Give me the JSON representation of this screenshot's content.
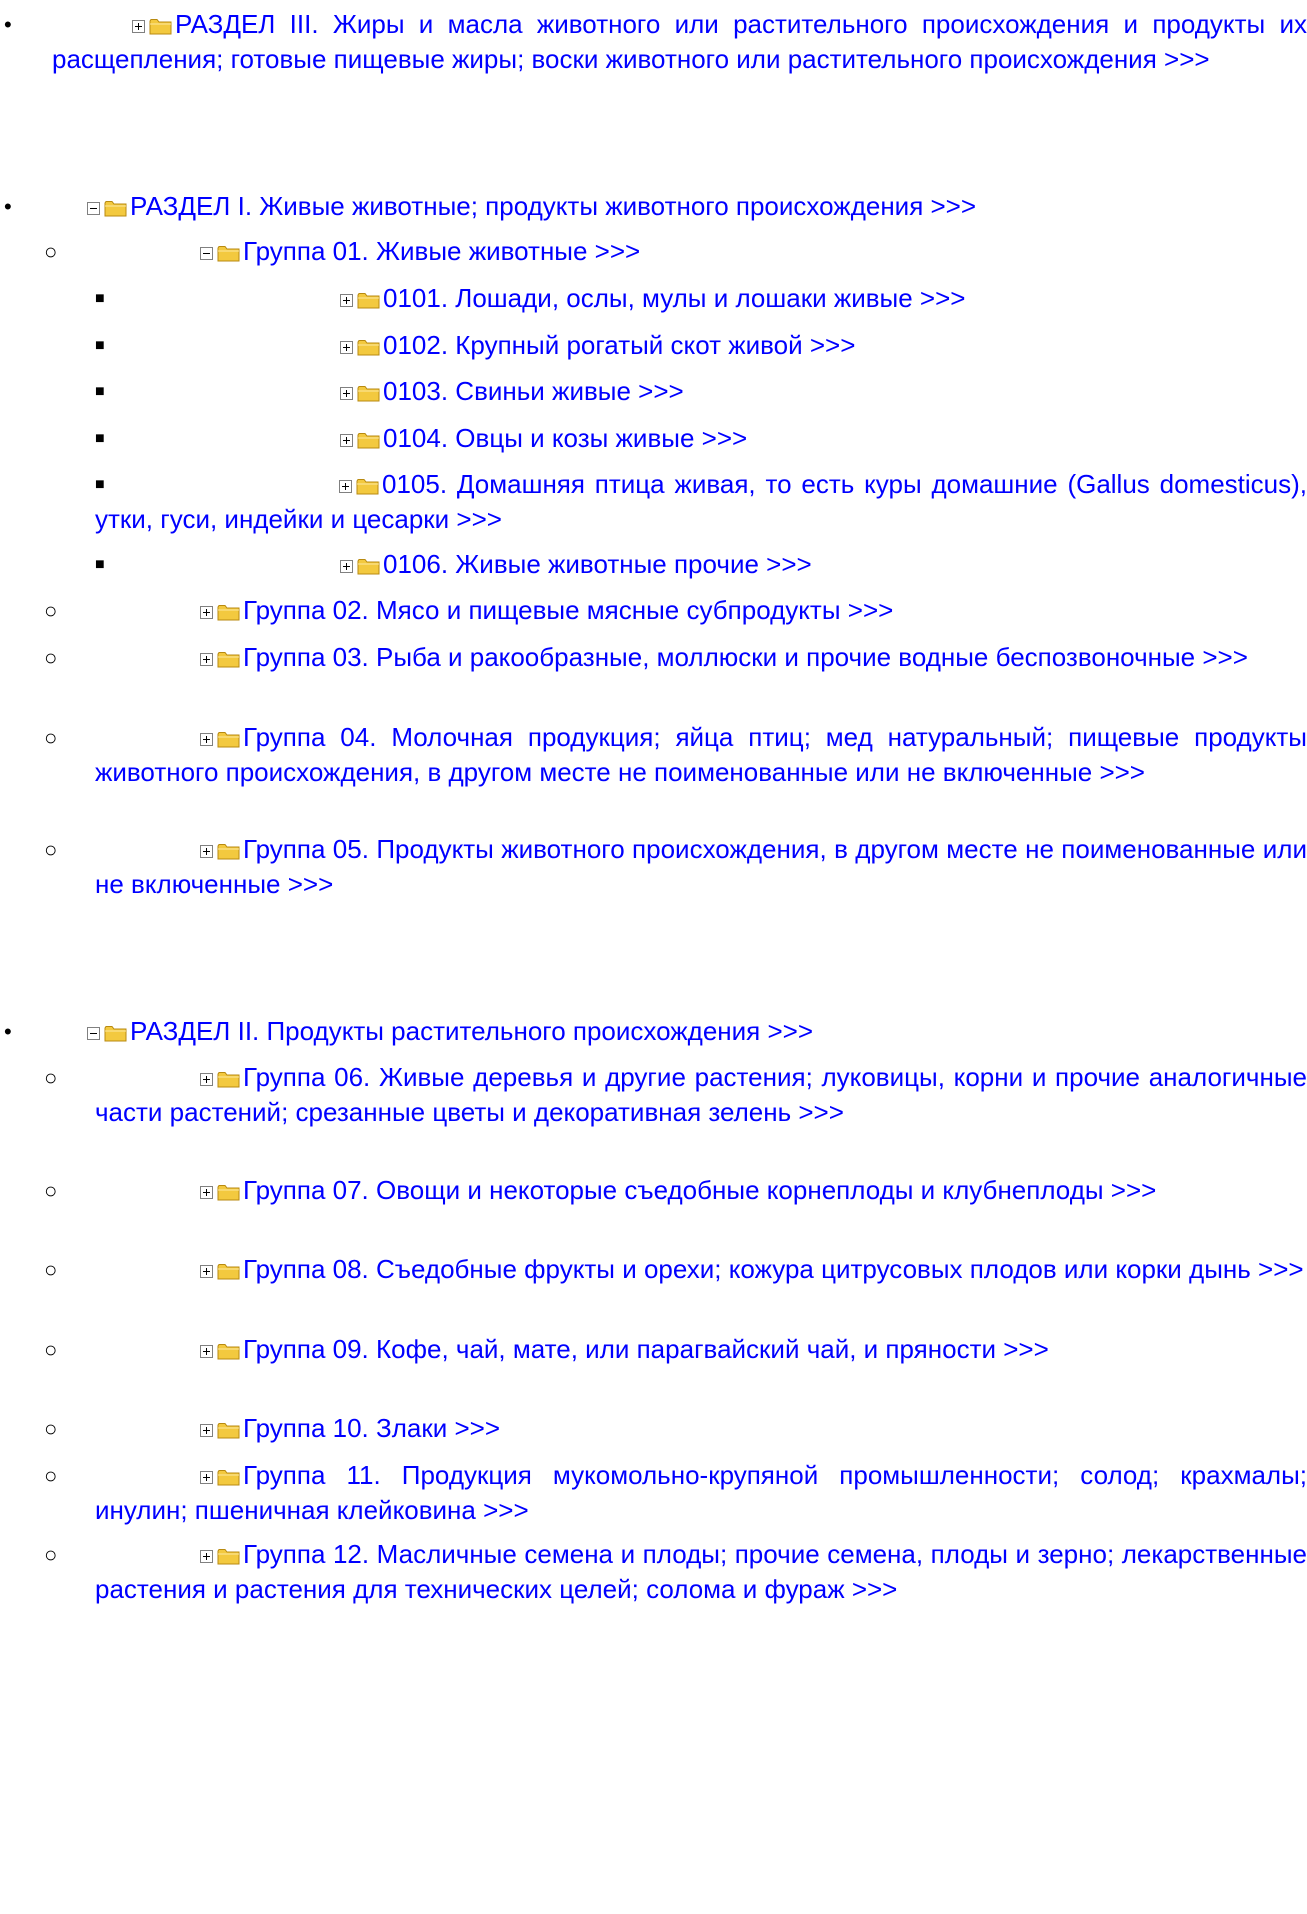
{
  "entries": [
    {
      "text": "РАЗДЕЛ III. Жиры и масла животного или растительного происхождения и продукты их расщепления; готовые пищевые жиры; воски животного или растительного происхождения >>>"
    },
    {
      "text": "РАЗДЕЛ I. Живые животные; продукты животного происхождения >>>"
    },
    {
      "text": "Группа 01. Живые животные >>>"
    },
    {
      "text": "0101. Лошади, ослы, мулы и лошаки живые >>>"
    },
    {
      "text": "0102. Крупный рогатый скот живой >>>"
    },
    {
      "text": "0103. Свиньи живые >>>"
    },
    {
      "text": "0104. Овцы и козы живые >>>"
    },
    {
      "text": "0105. Домашняя птица живая, то есть куры домашние (Gallus domesticus), утки, гуси, индейки и цесарки >>>"
    },
    {
      "text": "0106. Живые животные прочие >>>"
    },
    {
      "text": "Группа 02. Мясо и пищевые мясные субпродукты >>>"
    },
    {
      "text": "Группа 03. Рыба и ракообразные, моллюски и прочие водные беспозвоночные >>>"
    },
    {
      "text": "Группа 04. Молочная продукция; яйца птиц; мед натуральный; пищевые продукты животного происхождения, в другом месте не поименованные или не включенные >>>"
    },
    {
      "text": "Группа 05. Продукты животного происхождения, в другом месте не поименованные или не включенные >>>"
    },
    {
      "text": "РАЗДЕЛ II. Продукты растительного происхождения >>>"
    },
    {
      "text": "Группа 06. Живые деревья и другие растения; луковицы, корни и прочие аналогичные части растений; срезанные цветы и декоративная зелень >>>"
    },
    {
      "text": "Группа 07. Овощи и некоторые съедобные корнеплоды и клубнеплоды >>>"
    },
    {
      "text": "Группа 08. Съедобные фрукты и орехи; кожура цитрусовых плодов или корки дынь >>>"
    },
    {
      "text": "Группа 09. Кофе, чай, мате, или парагвайский чай, и пряности >>>"
    },
    {
      "text": "Группа 10. Злаки >>>"
    },
    {
      "text": "Группа 11. Продукция мукомольно-крупяной промышленности; солод; крахмалы; инулин; пшеничная клейковина >>>"
    },
    {
      "text": "Группа 12. Масличные семена и плоды; прочие семена, плоды и зерно; лекарственные растения и растения для технических целей; солома и фураж >>>"
    }
  ]
}
